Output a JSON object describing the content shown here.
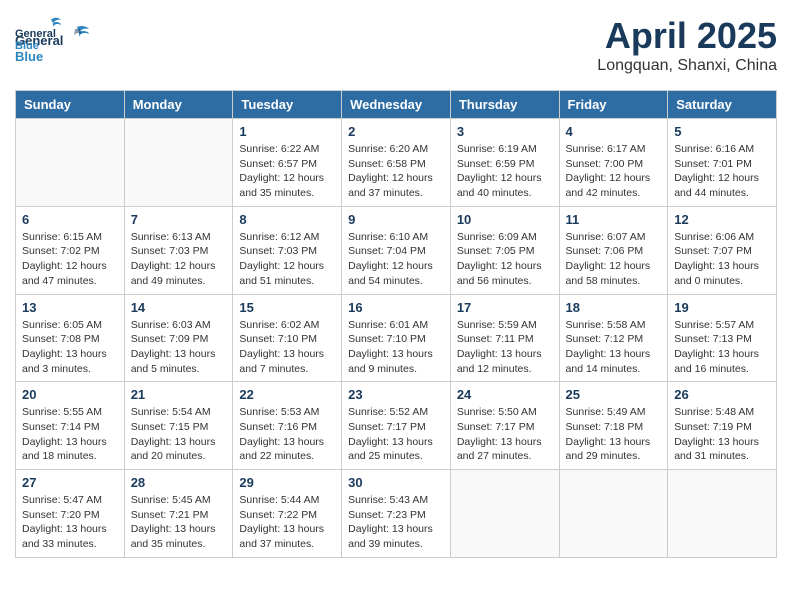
{
  "header": {
    "logo_general": "General",
    "logo_blue": "Blue",
    "month_title": "April 2025",
    "location": "Longquan, Shanxi, China"
  },
  "days_of_week": [
    "Sunday",
    "Monday",
    "Tuesday",
    "Wednesday",
    "Thursday",
    "Friday",
    "Saturday"
  ],
  "weeks": [
    [
      {
        "num": "",
        "info": ""
      },
      {
        "num": "",
        "info": ""
      },
      {
        "num": "1",
        "info": "Sunrise: 6:22 AM\nSunset: 6:57 PM\nDaylight: 12 hours and 35 minutes."
      },
      {
        "num": "2",
        "info": "Sunrise: 6:20 AM\nSunset: 6:58 PM\nDaylight: 12 hours and 37 minutes."
      },
      {
        "num": "3",
        "info": "Sunrise: 6:19 AM\nSunset: 6:59 PM\nDaylight: 12 hours and 40 minutes."
      },
      {
        "num": "4",
        "info": "Sunrise: 6:17 AM\nSunset: 7:00 PM\nDaylight: 12 hours and 42 minutes."
      },
      {
        "num": "5",
        "info": "Sunrise: 6:16 AM\nSunset: 7:01 PM\nDaylight: 12 hours and 44 minutes."
      }
    ],
    [
      {
        "num": "6",
        "info": "Sunrise: 6:15 AM\nSunset: 7:02 PM\nDaylight: 12 hours and 47 minutes."
      },
      {
        "num": "7",
        "info": "Sunrise: 6:13 AM\nSunset: 7:03 PM\nDaylight: 12 hours and 49 minutes."
      },
      {
        "num": "8",
        "info": "Sunrise: 6:12 AM\nSunset: 7:03 PM\nDaylight: 12 hours and 51 minutes."
      },
      {
        "num": "9",
        "info": "Sunrise: 6:10 AM\nSunset: 7:04 PM\nDaylight: 12 hours and 54 minutes."
      },
      {
        "num": "10",
        "info": "Sunrise: 6:09 AM\nSunset: 7:05 PM\nDaylight: 12 hours and 56 minutes."
      },
      {
        "num": "11",
        "info": "Sunrise: 6:07 AM\nSunset: 7:06 PM\nDaylight: 12 hours and 58 minutes."
      },
      {
        "num": "12",
        "info": "Sunrise: 6:06 AM\nSunset: 7:07 PM\nDaylight: 13 hours and 0 minutes."
      }
    ],
    [
      {
        "num": "13",
        "info": "Sunrise: 6:05 AM\nSunset: 7:08 PM\nDaylight: 13 hours and 3 minutes."
      },
      {
        "num": "14",
        "info": "Sunrise: 6:03 AM\nSunset: 7:09 PM\nDaylight: 13 hours and 5 minutes."
      },
      {
        "num": "15",
        "info": "Sunrise: 6:02 AM\nSunset: 7:10 PM\nDaylight: 13 hours and 7 minutes."
      },
      {
        "num": "16",
        "info": "Sunrise: 6:01 AM\nSunset: 7:10 PM\nDaylight: 13 hours and 9 minutes."
      },
      {
        "num": "17",
        "info": "Sunrise: 5:59 AM\nSunset: 7:11 PM\nDaylight: 13 hours and 12 minutes."
      },
      {
        "num": "18",
        "info": "Sunrise: 5:58 AM\nSunset: 7:12 PM\nDaylight: 13 hours and 14 minutes."
      },
      {
        "num": "19",
        "info": "Sunrise: 5:57 AM\nSunset: 7:13 PM\nDaylight: 13 hours and 16 minutes."
      }
    ],
    [
      {
        "num": "20",
        "info": "Sunrise: 5:55 AM\nSunset: 7:14 PM\nDaylight: 13 hours and 18 minutes."
      },
      {
        "num": "21",
        "info": "Sunrise: 5:54 AM\nSunset: 7:15 PM\nDaylight: 13 hours and 20 minutes."
      },
      {
        "num": "22",
        "info": "Sunrise: 5:53 AM\nSunset: 7:16 PM\nDaylight: 13 hours and 22 minutes."
      },
      {
        "num": "23",
        "info": "Sunrise: 5:52 AM\nSunset: 7:17 PM\nDaylight: 13 hours and 25 minutes."
      },
      {
        "num": "24",
        "info": "Sunrise: 5:50 AM\nSunset: 7:17 PM\nDaylight: 13 hours and 27 minutes."
      },
      {
        "num": "25",
        "info": "Sunrise: 5:49 AM\nSunset: 7:18 PM\nDaylight: 13 hours and 29 minutes."
      },
      {
        "num": "26",
        "info": "Sunrise: 5:48 AM\nSunset: 7:19 PM\nDaylight: 13 hours and 31 minutes."
      }
    ],
    [
      {
        "num": "27",
        "info": "Sunrise: 5:47 AM\nSunset: 7:20 PM\nDaylight: 13 hours and 33 minutes."
      },
      {
        "num": "28",
        "info": "Sunrise: 5:45 AM\nSunset: 7:21 PM\nDaylight: 13 hours and 35 minutes."
      },
      {
        "num": "29",
        "info": "Sunrise: 5:44 AM\nSunset: 7:22 PM\nDaylight: 13 hours and 37 minutes."
      },
      {
        "num": "30",
        "info": "Sunrise: 5:43 AM\nSunset: 7:23 PM\nDaylight: 13 hours and 39 minutes."
      },
      {
        "num": "",
        "info": ""
      },
      {
        "num": "",
        "info": ""
      },
      {
        "num": "",
        "info": ""
      }
    ]
  ]
}
